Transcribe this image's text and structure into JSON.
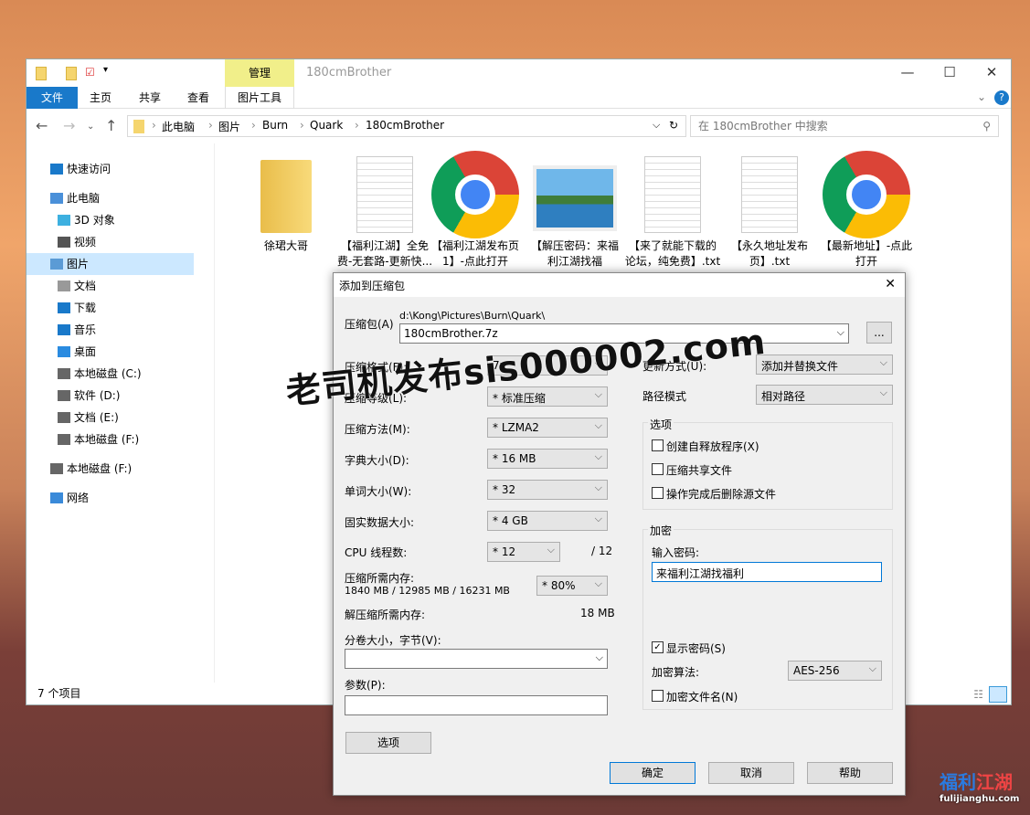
{
  "explorer": {
    "title": "180cmBrother",
    "contextual_tab": "管理",
    "contextual_group": "图片工具",
    "ribbon_tabs": [
      "文件",
      "主页",
      "共享",
      "查看"
    ],
    "breadcrumb": [
      "此电脑",
      "图片",
      "Burn",
      "Quark",
      "180cmBrother"
    ],
    "search_placeholder": "在 180cmBrother 中搜索",
    "sidebar": [
      {
        "label": "快速访问"
      },
      {
        "label": "此电脑"
      },
      {
        "label": "3D 对象"
      },
      {
        "label": "视频"
      },
      {
        "label": "图片",
        "selected": true
      },
      {
        "label": "文档"
      },
      {
        "label": "下载"
      },
      {
        "label": "音乐"
      },
      {
        "label": "桌面"
      },
      {
        "label": "本地磁盘 (C:)"
      },
      {
        "label": "软件 (D:)"
      },
      {
        "label": "文档 (E:)"
      },
      {
        "label": "本地磁盘 (F:)"
      },
      {
        "label": "本地磁盘 (F:)"
      },
      {
        "label": "网络"
      }
    ],
    "files": [
      {
        "name": "徐珺大哥",
        "type": "folder"
      },
      {
        "name": "【福利江湖】全免费-无套路-更新快...",
        "type": "text"
      },
      {
        "name": "【福利江湖发布页1】-点此打开",
        "type": "chrome"
      },
      {
        "name": "【解压密码：来福利江湖找福利】.jpg",
        "type": "image"
      },
      {
        "name": "【来了就能下载的论坛，纯免费】.txt",
        "type": "text"
      },
      {
        "name": "【永久地址发布页】.txt",
        "type": "text"
      },
      {
        "name": "【最新地址】-点此打开",
        "type": "chrome"
      }
    ],
    "status": "7 个项目"
  },
  "dialog": {
    "title": "添加到压缩包",
    "archive_label": "压缩包(A)",
    "archive_path": "d:\\Kong\\Pictures\\Burn\\Quark\\",
    "archive_name": "180cmBrother.7z",
    "browse": "...",
    "rows": [
      {
        "label": "压缩格式(F):",
        "value": "7z"
      },
      {
        "label": "压缩等级(L):",
        "value": "* 标准压缩"
      },
      {
        "label": "压缩方法(M):",
        "value": "* LZMA2"
      },
      {
        "label": "字典大小(D):",
        "value": "* 16 MB"
      },
      {
        "label": "单词大小(W):",
        "value": "* 32"
      },
      {
        "label": "固实数据大小:",
        "value": "* 4 GB"
      }
    ],
    "cpu_label": "CPU 线程数:",
    "cpu_value": "* 12",
    "cpu_max": "/ 12",
    "mem_label": "压缩所需内存:",
    "mem_value": "1840 MB / 12985 MB / 16231 MB",
    "mem_pct": "* 80%",
    "dmem_label": "解压缩所需内存:",
    "dmem_value": "18 MB",
    "split_label": "分卷大小，字节(V):",
    "params_label": "参数(P):",
    "options_btn": "选项",
    "update_label": "更新方式(U):",
    "update_value": "添加并替换文件",
    "path_label": "路径模式",
    "path_value": "相对路径",
    "options_group": "选项",
    "opt1": "创建自释放程序(X)",
    "opt2": "压缩共享文件",
    "opt3": "操作完成后删除源文件",
    "enc_group": "加密",
    "pwd_label": "输入密码:",
    "pwd_value": "来福利江湖找福利",
    "show_pwd": "显示密码(S)",
    "alg_label": "加密算法:",
    "alg_value": "AES-256",
    "enc_names": "加密文件名(N)",
    "ok": "确定",
    "cancel": "取消",
    "help": "帮助"
  },
  "watermark": "老司机发布sis000002.com",
  "logo": {
    "text": "福利江湖",
    "url": "fulijianghu.com"
  }
}
